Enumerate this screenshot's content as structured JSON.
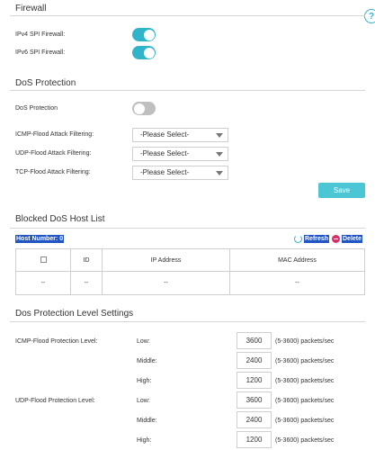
{
  "firewall": {
    "title": "Firewall",
    "ipv4_label": "IPv4 SPI Firewall:",
    "ipv6_label": "IPv6 SPI Firewall:",
    "ipv4_enabled": true,
    "ipv6_enabled": true,
    "help_icon": "?"
  },
  "dos": {
    "title": "DoS Protection",
    "protection_label": "DoS Protection",
    "protection_enabled": false,
    "icmp_label": "ICMP-Flood Attack Filtering:",
    "udp_label": "UDP-Flood Attack Filtering:",
    "tcp_label": "TCP-Flood Attack Filtering:",
    "icmp_value": "-Please Select-",
    "udp_value": "-Please Select-",
    "tcp_value": "-Please Select-",
    "save_label": "Save"
  },
  "blocked": {
    "title": "Blocked DoS Host List",
    "host_number": "Host Number: 0",
    "refresh_label": "Refresh",
    "delete_label": "Delete",
    "columns": [
      "ID",
      "IP Address",
      "MAC Address"
    ],
    "empty_row": [
      "--",
      "--",
      "--",
      "--"
    ]
  },
  "levels": {
    "title": "Dos Protection Level Settings",
    "icmp_label": "ICMP-Flood Protection Level:",
    "udp_label": "UDP-Flood Protection Level:",
    "low": "Low:",
    "middle": "Middle:",
    "high": "High:",
    "unit": "(5-3600) packets/sec",
    "icmp": {
      "low": "3600",
      "middle": "2400",
      "high": "1200"
    },
    "udp": {
      "low": "3600",
      "middle": "2400",
      "high": "1200"
    }
  },
  "colors": {
    "accent": "#2fb4c9",
    "save": "#4cc6d5",
    "selection": "#2155c4",
    "delete": "#d9306b"
  }
}
